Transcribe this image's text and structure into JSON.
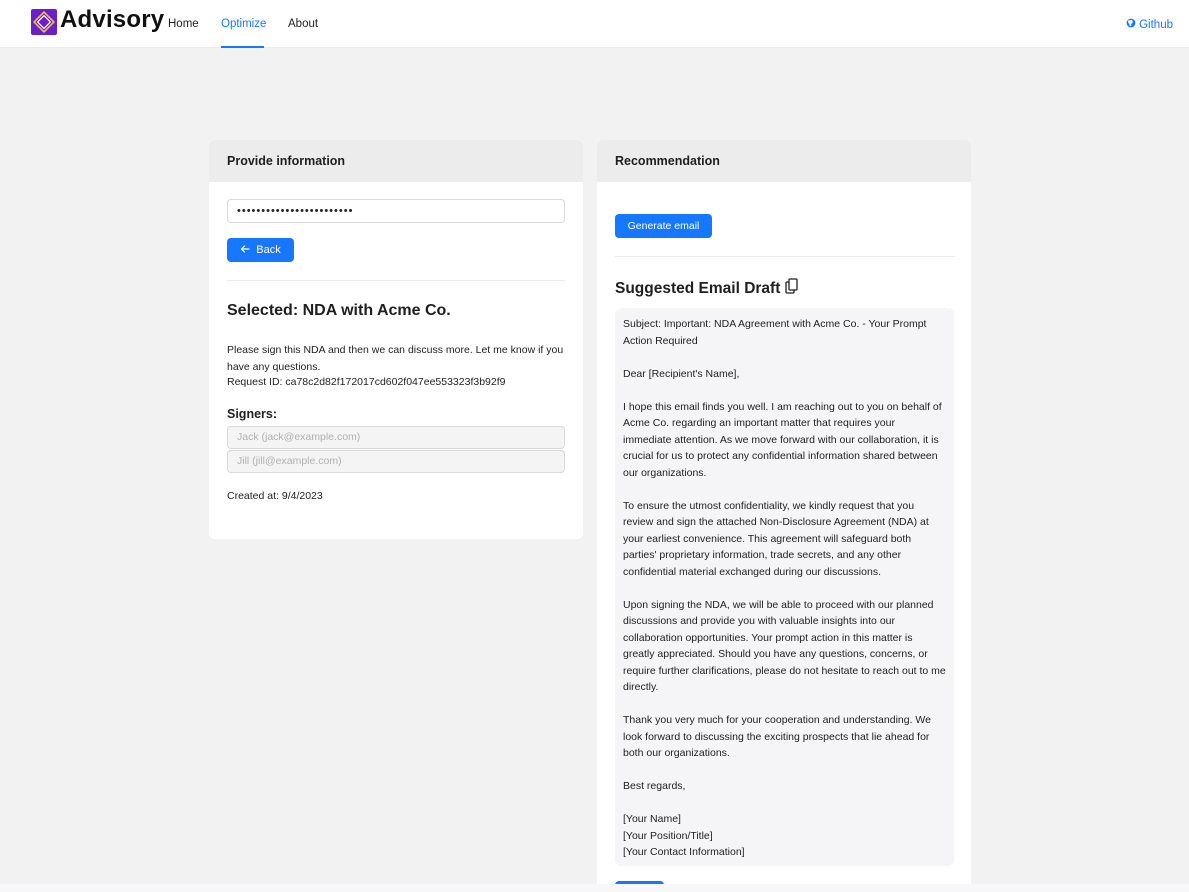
{
  "header": {
    "brand": "Advisory",
    "nav": [
      "Home",
      "Optimize",
      "About"
    ],
    "active_nav": "Optimize",
    "github_label": "Github"
  },
  "left_card": {
    "title": "Provide information",
    "password_value": "••••••••••••••••••••••••",
    "back_label": "Back",
    "selected_title": "Selected: NDA with Acme Co.",
    "description": "Please sign this NDA and then we can discuss more. Let me know if you have any questions.",
    "request_id": "Request ID: ca78c2d82f172017cd602f047ee553323f3b92f9",
    "signers_label": "Signers:",
    "signers": [
      "Jack (jack@example.com)",
      "Jill (jill@example.com)"
    ],
    "created_at": "Created at: 9/4/2023"
  },
  "right_card": {
    "title": "Recommendation",
    "generate_label": "Generate email",
    "draft_title": "Suggested Email Draft",
    "draft": {
      "subject": "Subject: Important: NDA Agreement with Acme Co. - Your Prompt Action Required",
      "greeting": "Dear [Recipient's Name],",
      "paragraphs": [
        "I hope this email finds you well. I am reaching out to you on behalf of Acme Co. regarding an important matter that requires your immediate attention. As we move forward with our collaboration, it is crucial for us to protect any confidential information shared between our organizations.",
        "To ensure the utmost confidentiality, we kindly request that you review and sign the attached Non-Disclosure Agreement (NDA) at your earliest convenience. This agreement will safeguard both parties' proprietary information, trade secrets, and any other confidential material exchanged during our discussions.",
        "Upon signing the NDA, we will be able to proceed with our planned discussions and provide you with valuable insights into our collaboration opportunities. Your prompt action in this matter is greatly appreciated. Should you have any questions, concerns, or require further clarifications, please do not hesitate to reach out to me directly.",
        "Thank you very much for your cooperation and understanding. We look forward to discussing the exciting prospects that lie ahead for both our organizations."
      ],
      "closing": "Best regards,",
      "signature": [
        "[Your Name]",
        "[Your Position/Title]",
        "[Your Contact Information]"
      ]
    }
  },
  "colors": {
    "accent": "#1677ff",
    "brand": "#6a1fc9",
    "page_bg": "#f2f2f2",
    "card_header_bg": "#ececec"
  },
  "icons": {
    "logo": "advisory-logo-icon",
    "github": "github-icon",
    "back": "arrow-left-icon",
    "copy": "copy-icon"
  }
}
